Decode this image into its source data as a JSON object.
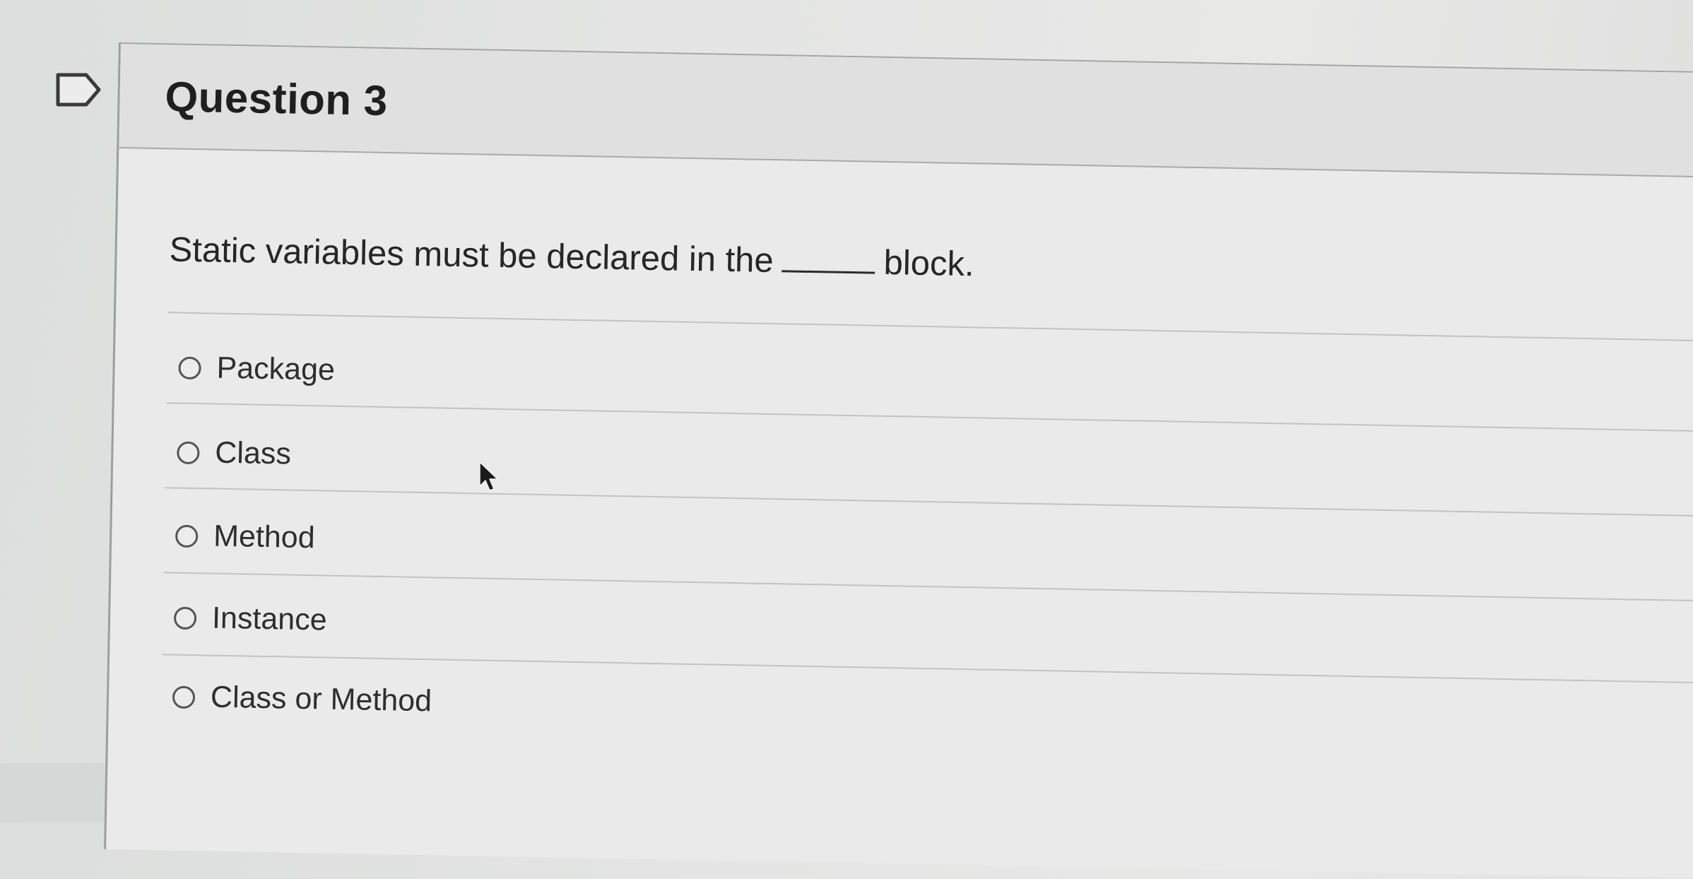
{
  "question": {
    "title": "Question 3",
    "text_before_blank": "Static variables must be declared in the",
    "text_after_blank": "block."
  },
  "answers": [
    {
      "label": "Package",
      "selected": false
    },
    {
      "label": "Class",
      "selected": false
    },
    {
      "label": "Method",
      "selected": false
    },
    {
      "label": "Instance",
      "selected": false
    },
    {
      "label": "Class or Method",
      "selected": false
    }
  ],
  "icons": {
    "flag": "flag-bookmark-icon",
    "cursor": "mouse-pointer-icon"
  },
  "colors": {
    "background": "#e4e5e4",
    "card": "#e9eae9",
    "header": "#dfe0df",
    "text": "#2b2b2b"
  }
}
